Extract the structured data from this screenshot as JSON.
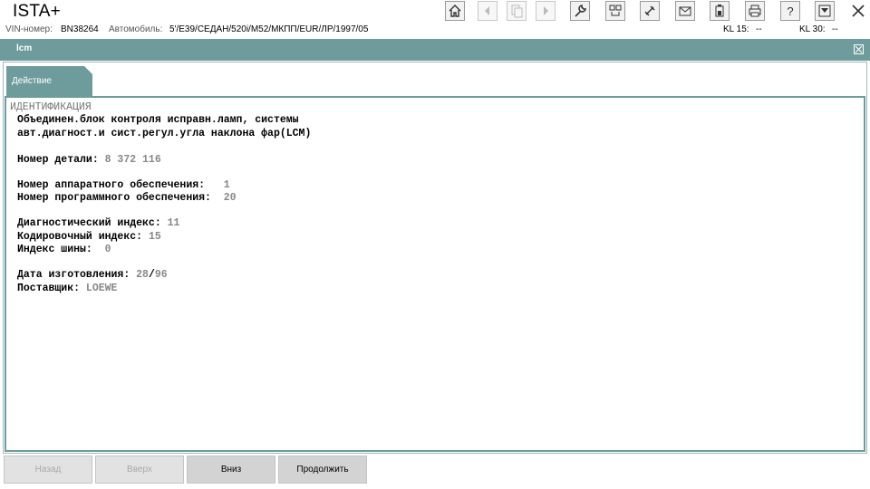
{
  "app": {
    "title": "ISTA+"
  },
  "toolbar": {
    "icons": [
      "home-icon",
      "back-icon",
      "copy-icon",
      "forward-icon",
      "wrench-icon",
      "service-icon",
      "link-icon",
      "mail-icon",
      "battery-icon",
      "print-icon",
      "help-icon",
      "expand-icon",
      "close-icon"
    ]
  },
  "vehicle": {
    "vin_label": "VIN-номер:",
    "vin_value": "BN38264",
    "car_label": "Автомобиль:",
    "car_value": "5'/E39/СЕДАН/520i/M52/МКПП/EUR/ЛР/1997/05",
    "kl15_label": "KL 15:",
    "kl15_value": "--",
    "kl30_label": "KL 30:",
    "kl30_value": "--"
  },
  "section": {
    "title": "lcm"
  },
  "tabs": [
    {
      "label": "Действие"
    }
  ],
  "content": {
    "heading": "ИДЕНТИФИКАЦИЯ",
    "description_line1": "Объединен.блок контроля исправн.ламп, системы",
    "description_line2": "авт.диагност.и сист.регул.угла наклона фар(LCM)",
    "part_number_label": "Номер детали:",
    "part_number_value": "8 372 116",
    "hw_label": "Номер аппаратного обеспечения:",
    "hw_value": "1",
    "sw_label": "Номер программного обеспечения:",
    "sw_value": "20",
    "diag_index_label": "Диагностический индекс:",
    "diag_index_value": "11",
    "coding_index_label": "Кодировочный индекс:",
    "coding_index_value": "15",
    "bus_index_label": "Индекс шины:",
    "bus_index_value": "0",
    "mfg_date_label": "Дата изготовления:",
    "mfg_date_week": "28",
    "mfg_date_sep": "/",
    "mfg_date_year": "96",
    "supplier_label": "Поставщик:",
    "supplier_value": "LOEWE"
  },
  "buttons": {
    "back": "Назад",
    "up": "Вверх",
    "down": "Вниз",
    "continue": "Продолжить"
  },
  "colors": {
    "accent": "#6e9c9c",
    "value_gray": "#888888"
  }
}
